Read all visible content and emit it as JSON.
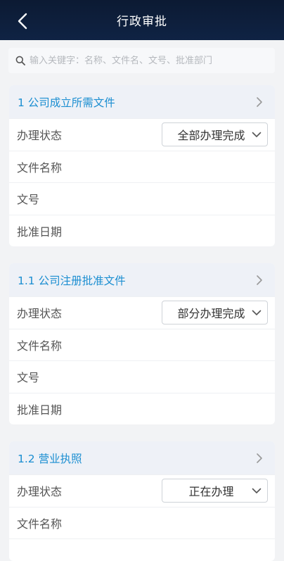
{
  "header": {
    "title": "行政审批"
  },
  "search": {
    "placeholder": "输入关键字：名称、文件名、文号、批准部门"
  },
  "cards": [
    {
      "title": "1  公司成立所需文件",
      "status_label": "办理状态",
      "status_value": "全部办理完成",
      "fields": [
        "文件名称",
        "文号",
        "批准日期"
      ]
    },
    {
      "title": "1.1  公司注册批准文件",
      "status_label": "办理状态",
      "status_value": "部分办理完成",
      "fields": [
        "文件名称",
        "文号",
        "批准日期"
      ]
    },
    {
      "title": "1.2  营业执照",
      "status_label": "办理状态",
      "status_value": "正在办理",
      "fields": [
        "文件名称"
      ]
    }
  ]
}
